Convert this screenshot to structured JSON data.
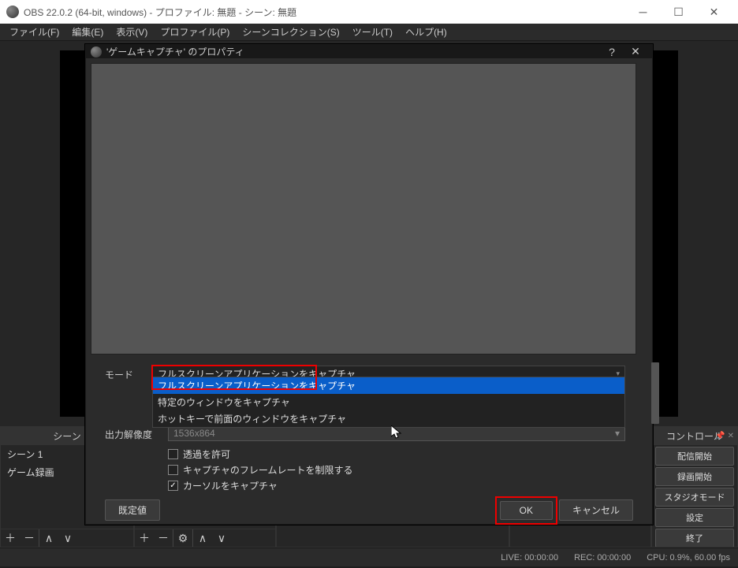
{
  "titlebar": {
    "title": "OBS 22.0.2 (64-bit, windows) - プロファイル: 無題 - シーン: 無題"
  },
  "menubar": {
    "items": [
      {
        "label": "ファイル(F)"
      },
      {
        "label": "編集(E)"
      },
      {
        "label": "表示(V)"
      },
      {
        "label": "プロファイル(P)"
      },
      {
        "label": "シーンコレクション(S)"
      },
      {
        "label": "ツール(T)"
      },
      {
        "label": "ヘルプ(H)"
      }
    ]
  },
  "panels": {
    "scenes": {
      "title": "シーン",
      "items": [
        {
          "label": "シーン 1"
        },
        {
          "label": "ゲーム録画"
        }
      ]
    },
    "controls": {
      "title": "コントロール",
      "buttons": [
        {
          "label": "配信開始"
        },
        {
          "label": "録画開始"
        },
        {
          "label": "スタジオモード"
        },
        {
          "label": "設定"
        },
        {
          "label": "終了"
        }
      ]
    }
  },
  "statusbar": {
    "live": "LIVE: 00:00:00",
    "rec": "REC: 00:00:00",
    "cpu": "CPU: 0.9%, 60.00 fps"
  },
  "dialog": {
    "title": "'ゲームキャプチャ' のプロパティ",
    "mode_label": "モード",
    "mode_value": "フルスクリーンアプリケーションをキャプチャ",
    "mode_options": [
      {
        "label": "フルスクリーンアプリケーションをキャプチャ",
        "selected": true
      },
      {
        "label": "特定のウィンドウをキャプチャ",
        "selected": false
      },
      {
        "label": "ホットキーで前面のウィンドウをキャプチャ",
        "selected": false
      }
    ],
    "resolution_label": "出力解像度",
    "resolution_value": "1536x864",
    "checkboxes": [
      {
        "label": "透過を許可",
        "checked": false
      },
      {
        "label": "キャプチャのフレームレートを制限する",
        "checked": false
      },
      {
        "label": "カーソルをキャプチャ",
        "checked": true
      }
    ],
    "buttons": {
      "defaults": "既定値",
      "ok": "OK",
      "cancel": "キャンセル"
    }
  }
}
